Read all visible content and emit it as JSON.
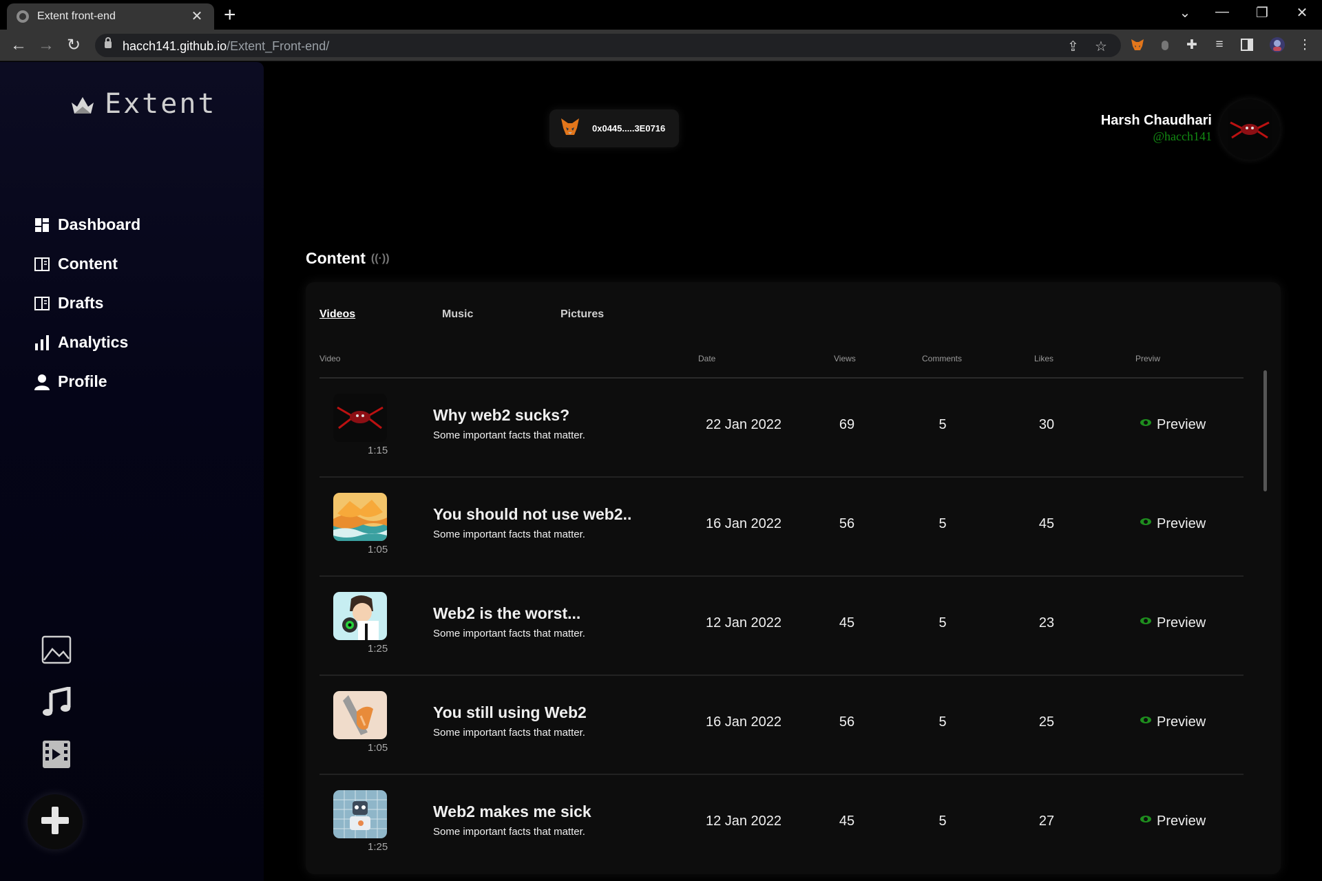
{
  "browser": {
    "tab_title": "Extent front-end",
    "url_host": "hacch141.github.io",
    "url_path": "/Extent_Front-end/"
  },
  "sidebar": {
    "logo_text": "Extent",
    "nav": [
      {
        "label": "Dashboard",
        "icon": "dashboard-icon"
      },
      {
        "label": "Content",
        "icon": "book-icon"
      },
      {
        "label": "Drafts",
        "icon": "book-icon"
      },
      {
        "label": "Analytics",
        "icon": "bar-chart-icon"
      },
      {
        "label": "Profile",
        "icon": "user-icon"
      }
    ],
    "media_buttons": [
      "image-icon",
      "music-icon",
      "video-icon"
    ],
    "add_button": "plus-icon"
  },
  "header": {
    "wallet_address": "0x0445.....3E0716",
    "user_name": "Harsh Chaudhari",
    "user_handle": "@hacch141"
  },
  "content": {
    "title": "Content",
    "tabs": [
      {
        "label": "Videos",
        "active": true
      },
      {
        "label": "Music",
        "active": false
      },
      {
        "label": "Pictures",
        "active": false
      }
    ],
    "columns": {
      "video": "Video",
      "date": "Date",
      "views": "Views",
      "comments": "Comments",
      "likes": "Likes",
      "preview": "Previw"
    },
    "rows": [
      {
        "title": "Why web2 sucks?",
        "subtitle": "Some important facts that matter.",
        "duration": "1:15",
        "date": "22 Jan 2022",
        "views": "69",
        "comments": "5",
        "likes": "30",
        "preview": "Preview",
        "thumb": "spider"
      },
      {
        "title": "You should not use web2..",
        "subtitle": "Some important facts that matter.",
        "duration": "1:05",
        "date": "16 Jan 2022",
        "views": "56",
        "comments": "5",
        "likes": "45",
        "preview": "Preview",
        "thumb": "layers"
      },
      {
        "title": "Web2 is the worst...",
        "subtitle": "Some important facts that matter.",
        "duration": "1:25",
        "date": "12 Jan 2022",
        "views": "45",
        "comments": "5",
        "likes": "23",
        "preview": "Preview",
        "thumb": "cartoon"
      },
      {
        "title": "You still using Web2",
        "subtitle": "Some important facts that matter.",
        "duration": "1:05",
        "date": "16 Jan 2022",
        "views": "56",
        "comments": "5",
        "likes": "25",
        "preview": "Preview",
        "thumb": "abstract"
      },
      {
        "title": "Web2 makes me sick",
        "subtitle": "Some important facts that matter.",
        "duration": "1:25",
        "date": "12 Jan 2022",
        "views": "45",
        "comments": "5",
        "likes": "27",
        "preview": "Preview",
        "thumb": "robot"
      }
    ]
  },
  "colors": {
    "accent_green": "#128a12",
    "sidebar_bg": "#050518",
    "panel_bg": "#0d0d0d"
  }
}
